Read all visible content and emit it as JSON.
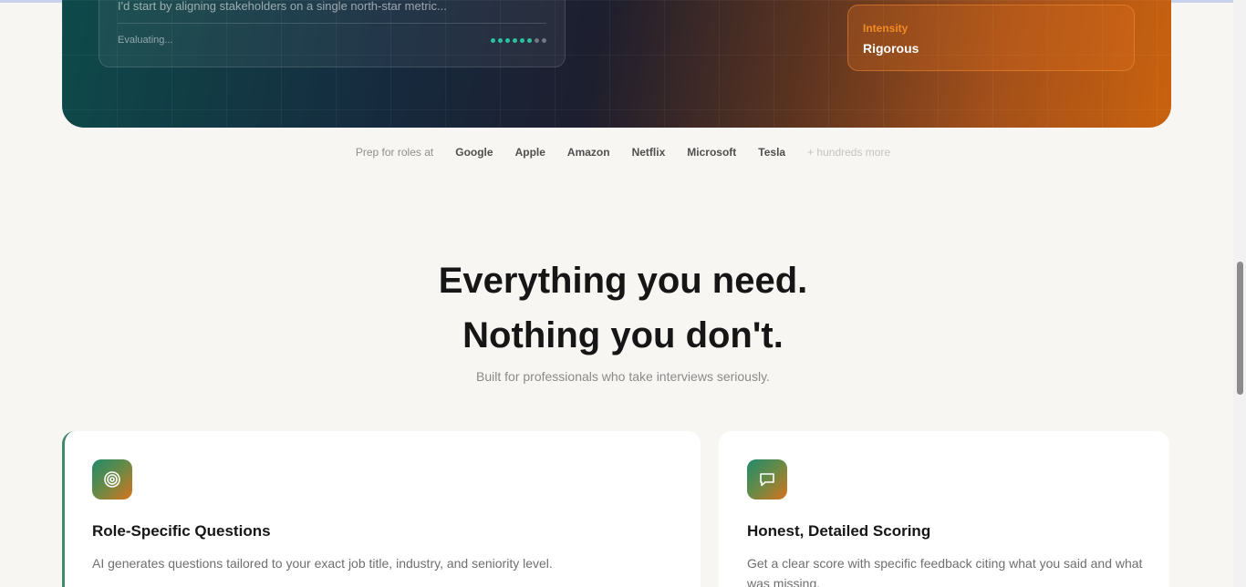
{
  "hero": {
    "chat_text": "I'd start by aligning stakeholders on a single north-star metric...",
    "chat_status": "Evaluating...",
    "progress": {
      "filled": 6,
      "total": 8
    },
    "intensity_label": "Intensity",
    "intensity_value": "Rigorous"
  },
  "logos": {
    "prefix": "Prep for roles at",
    "companies": [
      "Google",
      "Apple",
      "Amazon",
      "Netflix",
      "Microsoft",
      "Tesla"
    ],
    "suffix": "+ hundreds more"
  },
  "features_section": {
    "headline_line1": "Everything you need.",
    "headline_line2": "Nothing you don't.",
    "subhead": "Built for professionals who take interviews seriously."
  },
  "features": [
    {
      "icon": "target-icon",
      "title": "Role-Specific Questions",
      "description": "AI generates questions tailored to your exact job title, industry, and seniority level."
    },
    {
      "icon": "chat-bubble-icon",
      "title": "Honest, Detailed Scoring",
      "description": "Get a clear score with specific feedback citing what you said and what was missing."
    }
  ],
  "colors": {
    "accent_teal": "#2bc2a0",
    "accent_orange": "#f28a26"
  }
}
